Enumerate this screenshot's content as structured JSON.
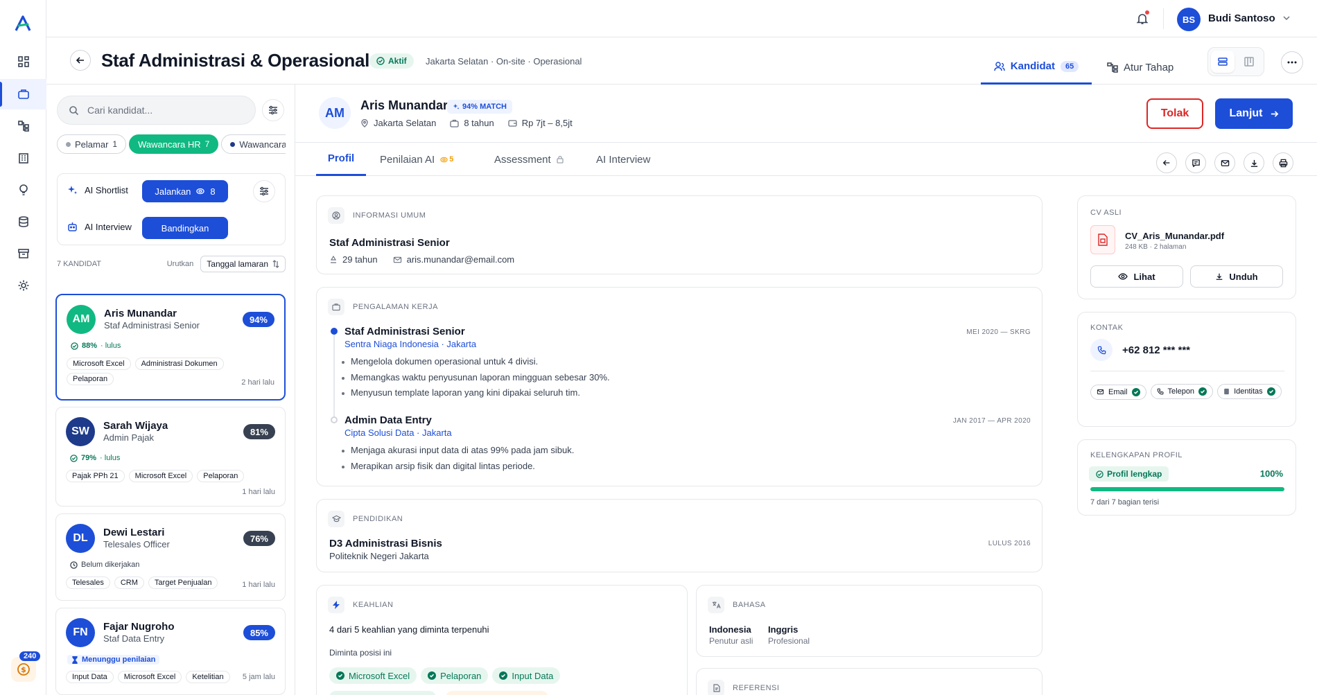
{
  "topbar": {
    "user_initials": "BS",
    "user_name": "Budi Santoso"
  },
  "rail": {
    "credit_badge": "240"
  },
  "job": {
    "title": "Staf Administrasi & Operasional",
    "status": "Aktif",
    "meta": "Jakarta Selatan · On-site · Operasional",
    "tabs": [
      {
        "label": "Kandidat",
        "count": "65"
      },
      {
        "label": "Atur Tahap"
      }
    ]
  },
  "left": {
    "search_placeholder": "Cari kandidat...",
    "stages": [
      {
        "label": "Pelamar",
        "count": "1"
      },
      {
        "label": "Wawancara HR",
        "count": "7"
      },
      {
        "label": "Wawancara"
      }
    ],
    "ai": {
      "shortlist_label": "AI Shortlist",
      "run_label": "Jalankan",
      "run_count": "8",
      "interview_label": "AI Interview",
      "compare_label": "Bandingkan"
    },
    "list_count": "7 KANDIDAT",
    "sort_label": "Urutkan",
    "sort_value": "Tanggal lamaran",
    "candidates": [
      {
        "initials": "AM",
        "name": "Aris Munandar",
        "role": "Staf Administrasi Senior",
        "score": "94%",
        "status_pct": "88%",
        "status_text": "· lulus",
        "tags": [
          "Microsoft Excel",
          "Administrasi Dokumen",
          "Pelaporan"
        ],
        "time": "2 hari lalu",
        "avatar_color": "#10b981",
        "score_color": "#1d4ed8"
      },
      {
        "initials": "SW",
        "name": "Sarah Wijaya",
        "role": "Admin Pajak",
        "score": "81%",
        "status_pct": "79%",
        "status_text": "· lulus",
        "tags": [
          "Pajak PPh 21",
          "Microsoft Excel",
          "Pelaporan"
        ],
        "time": "1 hari lalu",
        "avatar_color": "#1e3a8a",
        "score_color": "#374151"
      },
      {
        "initials": "DL",
        "name": "Dewi Lestari",
        "role": "Telesales Officer",
        "score": "76%",
        "status_text": "Belum dikerjakan",
        "tags": [
          "Telesales",
          "CRM",
          "Target Penjualan"
        ],
        "time": "1 hari lalu",
        "avatar_color": "#1d4ed8",
        "score_color": "#374151"
      },
      {
        "initials": "FN",
        "name": "Fajar Nugroho",
        "role": "Staf Data Entry",
        "score": "85%",
        "status_text": "Menunggu penilaian",
        "tags": [
          "Input Data",
          "Microsoft Excel",
          "Ketelitian"
        ],
        "time": "5 jam lalu",
        "avatar_color": "#1d4ed8",
        "score_color": "#1d4ed8"
      }
    ]
  },
  "candidate": {
    "initials": "AM",
    "name": "Aris Munandar",
    "match": "94% MATCH",
    "location": "Jakarta Selatan",
    "experience": "8 tahun",
    "salary": "Rp 7jt – 8,5jt",
    "reject_label": "Tolak",
    "next_label": "Lanjut",
    "tabs": [
      {
        "label": "Profil"
      },
      {
        "label": "Penilaian AI",
        "badge": "5"
      },
      {
        "label": "Assessment"
      },
      {
        "label": "AI Interview"
      }
    ]
  },
  "profile": {
    "general": {
      "heading": "INFORMASI UMUM",
      "title": "Staf Administrasi Senior",
      "age": "29 tahun",
      "email": "aris.munandar@email.com"
    },
    "experience": {
      "heading": "PENGALAMAN KERJA",
      "items": [
        {
          "role": "Staf Administrasi Senior",
          "org": "Sentra Niaga Indonesia · Jakarta",
          "period": "MEI 2020 — SKRG",
          "bullets": [
            "Mengelola dokumen operasional untuk 4 divisi.",
            "Memangkas waktu penyusunan laporan mingguan sebesar 30%.",
            "Menyusun template laporan yang kini dipakai seluruh tim."
          ]
        },
        {
          "role": "Admin Data Entry",
          "org": "Cipta Solusi Data · Jakarta",
          "period": "JAN 2017 — APR 2020",
          "bullets": [
            "Menjaga akurasi input data di atas 99% pada jam sibuk.",
            "Merapikan arsip fisik dan digital lintas periode."
          ]
        }
      ]
    },
    "education": {
      "heading": "PENDIDIKAN",
      "degree": "D3 Administrasi Bisnis",
      "school": "Politeknik Negeri Jakarta",
      "year": "LULUS 2016"
    },
    "skills": {
      "heading": "KEAHLIAN",
      "summary": "4 dari 5 keahlian yang diminta terpenuhi",
      "sub": "Diminta posisi ini",
      "items": [
        "Microsoft Excel",
        "Pelaporan",
        "Input Data"
      ]
    },
    "languages": {
      "heading": "BAHASA",
      "items": [
        {
          "name": "Indonesia",
          "level": "Penutur asli"
        },
        {
          "name": "Inggris",
          "level": "Profesional"
        }
      ]
    },
    "references": {
      "heading": "REFERENSI"
    }
  },
  "side": {
    "cv": {
      "heading": "CV ASLI",
      "file": "CV_Aris_Munandar.pdf",
      "meta": "248 KB · 2 halaman",
      "view_label": "Lihat",
      "download_label": "Unduh"
    },
    "contact": {
      "heading": "KONTAK",
      "phone": "+62 812 *** ***",
      "chips": [
        "Email",
        "Telepon",
        "Identitas"
      ]
    },
    "completeness": {
      "heading": "KELENGKAPAN PROFIL",
      "badge": "Profil lengkap",
      "percent": "100%",
      "fill": 1.0,
      "note": "7 dari 7 bagian terisi"
    }
  },
  "colors": {
    "primary": "#1d4ed8",
    "success": "#10b981",
    "danger": "#dc2626"
  }
}
